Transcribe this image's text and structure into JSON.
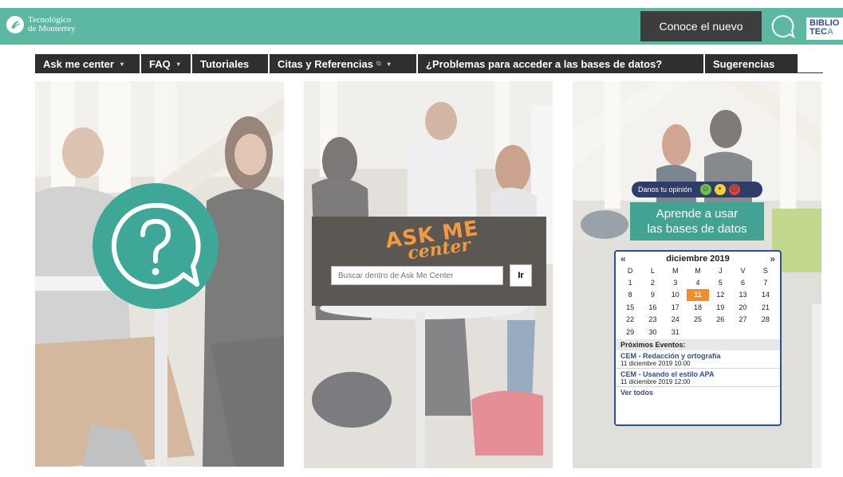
{
  "header": {
    "logo_line1": "Tecnológico",
    "logo_line2": "de Monterrey",
    "promo": "Conoce el nuevo",
    "biblio_line1": "BIBLIO",
    "biblio_line2_a": "TEC",
    "biblio_line2_b": "A",
    "colors": {
      "bar": "#5cb8a3",
      "promo_bg": "#3d3d3d"
    }
  },
  "nav": {
    "items": [
      {
        "label": "Ask me center",
        "caret": "▾"
      },
      {
        "label": "FAQ",
        "caret": "▾"
      },
      {
        "label": "Tutoriales"
      },
      {
        "label": "Citas y Referencias",
        "caret": "▾"
      },
      {
        "label": "¿Problemas para acceder a las bases de datos?"
      },
      {
        "label": "Sugerencias"
      }
    ]
  },
  "ask": {
    "line1": "ASK ME",
    "line2": "center",
    "search_placeholder": "Buscar dentro de Ask Me Center",
    "search_button": "Ir"
  },
  "opinion": {
    "label": "Danos tu opinión"
  },
  "learn": {
    "line1": "Aprende a usar",
    "line2": "las bases de datos"
  },
  "calendar": {
    "prev": "«",
    "next": "»",
    "month": "diciembre 2019",
    "weekdays": [
      "D",
      "L",
      "M",
      "M",
      "J",
      "V",
      "S"
    ],
    "weeks": [
      [
        "1",
        "2",
        "3",
        "4",
        "5",
        "6",
        "7"
      ],
      [
        "8",
        "9",
        "10",
        "11",
        "12",
        "13",
        "14"
      ],
      [
        "15",
        "16",
        "17",
        "18",
        "19",
        "20",
        "21"
      ],
      [
        "22",
        "23",
        "24",
        "25",
        "26",
        "27",
        "28"
      ],
      [
        "29",
        "30",
        "31",
        "",
        "",
        "",
        ""
      ]
    ],
    "today": "11",
    "events_title": "Próximos Eventos:",
    "events": [
      {
        "title": "CEM - Redacción y ortografía",
        "date": "11 diciembre 2019 10:00"
      },
      {
        "title": "CEM - Usando el estilo APA",
        "date": "11 diciembre 2019 12:00"
      }
    ],
    "see_all": "Ver todos"
  }
}
